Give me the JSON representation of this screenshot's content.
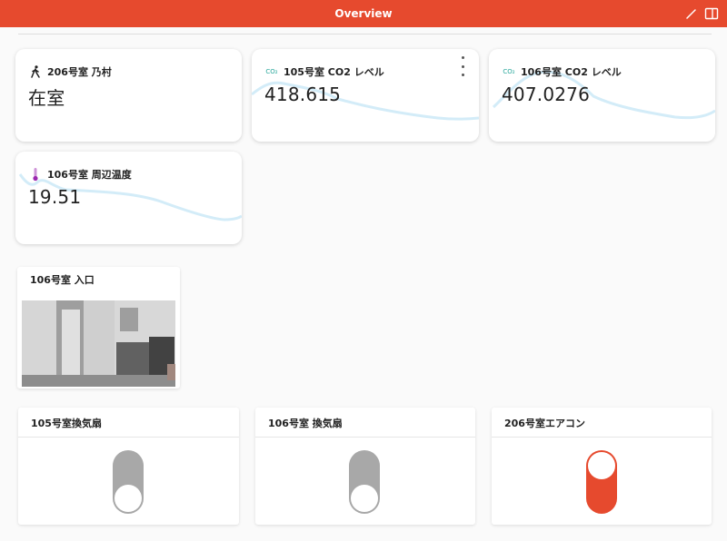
{
  "header": {
    "title": "Overview",
    "edit_icon": "pencil-icon",
    "sidebar_icon": "sidebar-toggle-icon"
  },
  "colors": {
    "header": "#e64a2e",
    "toggle_on": "#e64a2e",
    "toggle_off": "#a8a8a8",
    "spark": "#d3ecf8",
    "co2_icon": "#26a69a",
    "thermometer": "#9c27b0"
  },
  "cards": [
    {
      "icon": "walking-person-icon",
      "title": "206号室 乃村",
      "value": "在室"
    },
    {
      "icon": "co2-icon",
      "icon_text": "CO₂",
      "title": "105号室 CO2 レベル",
      "value": "418.615"
    },
    {
      "icon": "co2-icon",
      "icon_text": "CO₂",
      "title": "106号室 CO2 レベル",
      "value": "407.0276"
    },
    {
      "icon": "thermometer-icon",
      "title": "106号室 周辺温度",
      "value": "19.51"
    }
  ],
  "camera": {
    "title": "106号室 入口"
  },
  "switches": [
    {
      "title": "105号室換気扇",
      "state": "off"
    },
    {
      "title": "106号室 換気扇",
      "state": "off"
    },
    {
      "title": "206号室エアコン",
      "state": "on"
    }
  ]
}
